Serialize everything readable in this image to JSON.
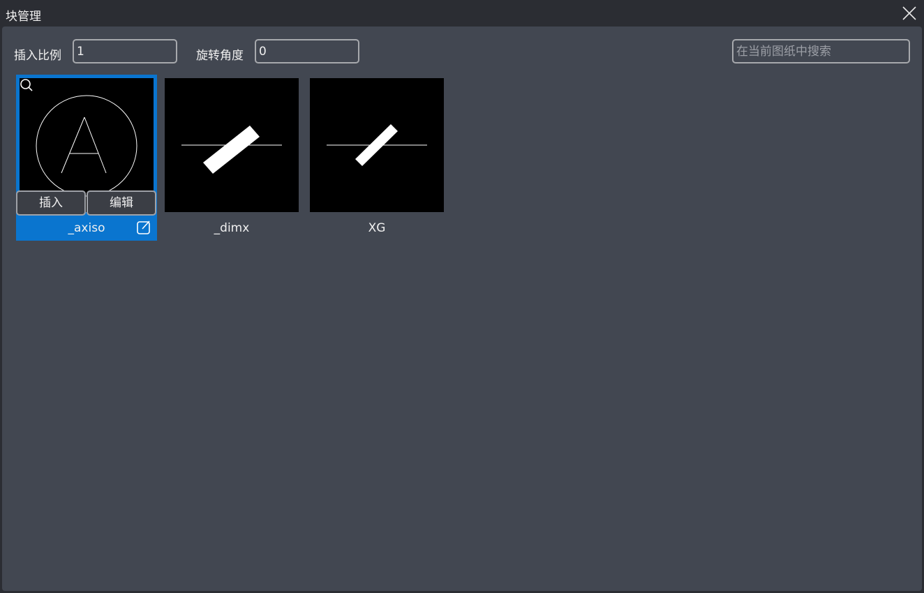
{
  "window": {
    "title": "块管理",
    "close_icon": "close-icon"
  },
  "toolbar": {
    "scale_label": "插入比例",
    "scale_value": "1",
    "rotation_label": "旋转角度",
    "rotation_value": "0",
    "search_placeholder": "在当前图纸中搜索"
  },
  "blocks": [
    {
      "name": "_axiso",
      "selected": true,
      "insert_label": "插入",
      "edit_label": "编辑"
    },
    {
      "name": "_dimx",
      "selected": false
    },
    {
      "name": "XG",
      "selected": false
    }
  ],
  "colors": {
    "accent": "#0a75cf",
    "panel": "#424751",
    "titlebar": "#2b2d33"
  }
}
